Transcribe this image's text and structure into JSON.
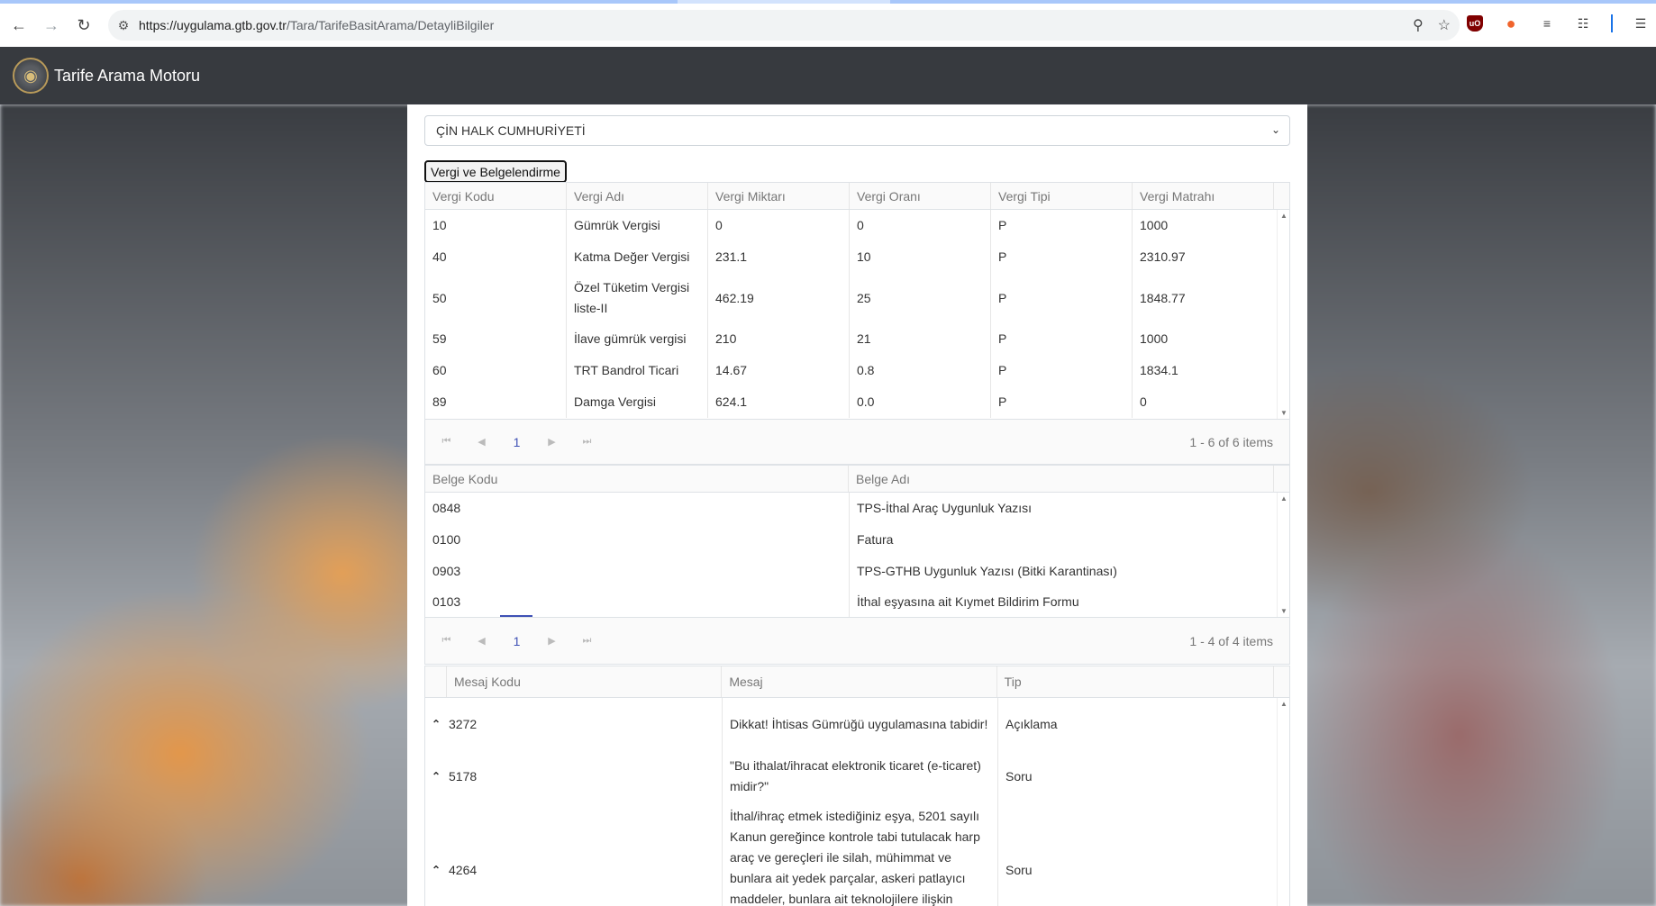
{
  "browser": {
    "url_host": "https://uygulama.gtb.gov.tr",
    "url_path": "/Tara/TarifeBasitArama/DetayliBilgiler"
  },
  "app": {
    "title": "Tarife Arama Motoru"
  },
  "country_select": {
    "value": "ÇİN HALK CUMHURİYETİ"
  },
  "tab_button": {
    "label": "Vergi ve Belgelendirme"
  },
  "tax_table": {
    "headers": [
      "Vergi Kodu",
      "Vergi Adı",
      "Vergi Miktarı",
      "Vergi Oranı",
      "Vergi Tipi",
      "Vergi Matrahı"
    ],
    "rows": [
      [
        "10",
        "Gümrük Vergisi",
        "0",
        "0",
        "P",
        "1000"
      ],
      [
        "40",
        "Katma Değer Vergisi",
        "231.1",
        "10",
        "P",
        "2310.97"
      ],
      [
        "50",
        "Özel Tüketim Vergisi liste-II",
        "462.19",
        "25",
        "P",
        "1848.77"
      ],
      [
        "59",
        "İlave gümrük vergisi",
        "210",
        "21",
        "P",
        "1000"
      ],
      [
        "60",
        "TRT Bandrol Ticari",
        "14.67",
        "0.8",
        "P",
        "1834.1"
      ],
      [
        "89",
        "Damga Vergisi",
        "624.1",
        "0.0",
        "P",
        "0"
      ]
    ],
    "pager": {
      "page": "1",
      "info": "1 - 6 of 6 items"
    }
  },
  "doc_table": {
    "headers": [
      "Belge Kodu",
      "Belge Adı"
    ],
    "rows": [
      [
        "0848",
        "TPS-İthal Araç Uygunluk Yazısı"
      ],
      [
        "0100",
        "Fatura"
      ],
      [
        "0903",
        "TPS-GTHB Uygunluk Yazısı (Bitki Karantinası)"
      ],
      [
        "0103",
        "İthal eşyasına ait Kıymet Bildirim Formu"
      ]
    ],
    "pager": {
      "page": "1",
      "info": "1 - 4 of 4 items"
    }
  },
  "msg_table": {
    "headers": [
      "Mesaj Kodu",
      "Mesaj",
      "Tip"
    ],
    "rows": [
      [
        "3272",
        "Dikkat! İhtisas Gümrüğü uygulamasına tabidir!",
        "Açıklama"
      ],
      [
        "5178",
        "\"Bu ithalat/ihracat elektronik ticaret (e-ticaret) midir?\"",
        "Soru"
      ],
      [
        "4264",
        "İthal/ihraç etmek istediğiniz eşya, 5201 sayılı Kanun gereğince kontrole tabi tutulacak harp araç ve gereçleri ile silah, mühimmat ve bunlara ait yedek parçalar, askeri patlayıcı maddeler, bunlara ait teknolojilere ilişkin",
        "Soru"
      ]
    ]
  }
}
